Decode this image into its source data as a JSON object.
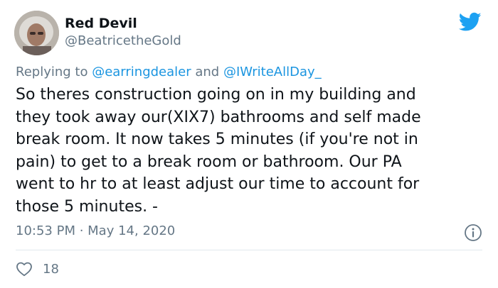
{
  "author": {
    "display_name": "Red Devil",
    "handle": "@BeatricetheGold"
  },
  "reply": {
    "prefix": "Replying to ",
    "mention_1": "@earringdealer",
    "joiner": " and ",
    "mention_2": "@IWriteAllDay_"
  },
  "tweet": {
    "lines": [
      "So theres construction going on in my building and",
      "they took away our(XIX7) bathrooms and self made",
      "break room. It now takes 5 minutes (if you're not in",
      "pain) to get to a break room or bathroom. Our PA",
      "went to hr to at least adjust our time to account for",
      "those 5 minutes. -"
    ]
  },
  "meta": {
    "time": "10:53 PM",
    "separator": " · ",
    "date": "May 14, 2020"
  },
  "stats": {
    "likes": "18"
  },
  "icons": {
    "logo": "twitter-bird-icon",
    "info": "info-icon",
    "like": "heart-icon"
  },
  "colors": {
    "brand": "#1da1f2",
    "link": "#1b95e0",
    "secondary_text": "#657786",
    "divider": "#e1e8ed"
  }
}
